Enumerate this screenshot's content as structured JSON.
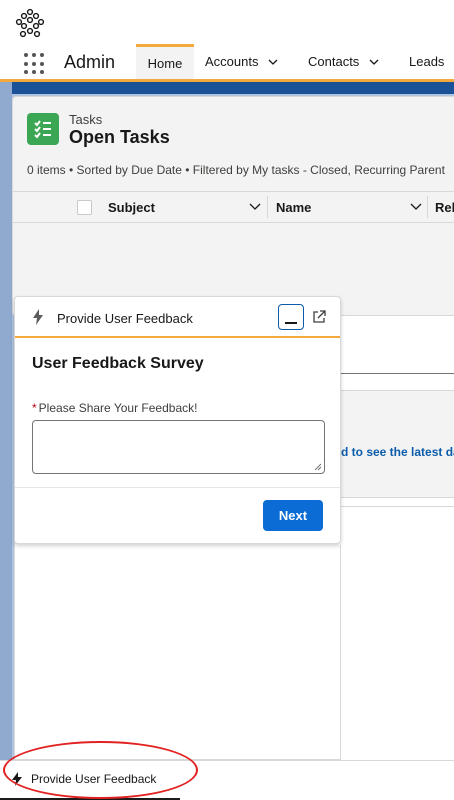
{
  "header": {
    "logo_icon": "org-logo-icon"
  },
  "nav": {
    "app_name": "Admin",
    "tabs": [
      {
        "label": "Home",
        "active": true
      },
      {
        "label": "Accounts",
        "has_menu": true
      },
      {
        "label": "Contacts",
        "has_menu": true
      },
      {
        "label": "Leads"
      }
    ],
    "accent_color": "#f3a93c"
  },
  "tasks": {
    "object_label": "Tasks",
    "list_title": "Open Tasks",
    "meta": "0 items • Sorted by Due Date • Filtered by My tasks - Closed, Recurring Parent",
    "columns": [
      "Subject",
      "Name",
      "Rel"
    ]
  },
  "flow": {
    "header_label": "Provide User Feedback",
    "title": "User Feedback Survey",
    "field_required_mark": "*",
    "field_label": "Please Share Your Feedback!",
    "field_value": "",
    "next_label": "Next",
    "button_color": "#0b6cd6"
  },
  "background": {
    "update_text": "d to see the latest da"
  },
  "utility_bar": {
    "item_label": "Provide User Feedback",
    "highlight_color": "#e22222"
  }
}
